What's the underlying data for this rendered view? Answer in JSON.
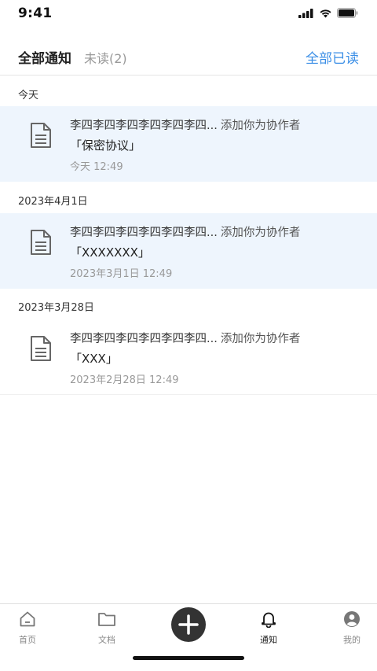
{
  "status": {
    "time": "9:41"
  },
  "header": {
    "tab_all": "全部通知",
    "tab_unread": "未读(2)",
    "mark_all_read": "全部已读"
  },
  "sections": [
    {
      "label": "今天",
      "item": {
        "sender": "李四李四李四李四李四李四...",
        "action": "添加你为协作者",
        "doc": "「保密协议」",
        "time": "今天 12:49",
        "unread": true
      }
    },
    {
      "label": "2023年4月1日",
      "item": {
        "sender": "李四李四李四李四李四李四...",
        "action": "添加你为协作者",
        "doc": "「XXXXXXX」",
        "time": "2023年3月1日 12:49",
        "unread": true
      }
    },
    {
      "label": "2023年3月28日",
      "item": {
        "sender": "李四李四李四李四李四李四...",
        "action": "添加你为协作者",
        "doc": "「XXX」",
        "time": "2023年2月28日 12:49",
        "unread": false
      }
    }
  ],
  "tabbar": {
    "home": "首页",
    "docs": "文档",
    "notify": "通知",
    "mine": "我的"
  },
  "icons": [
    "signal-icon",
    "wifi-icon",
    "battery-icon",
    "document-icon",
    "home-icon",
    "folder-icon",
    "plus-icon",
    "bell-icon",
    "user-icon"
  ]
}
